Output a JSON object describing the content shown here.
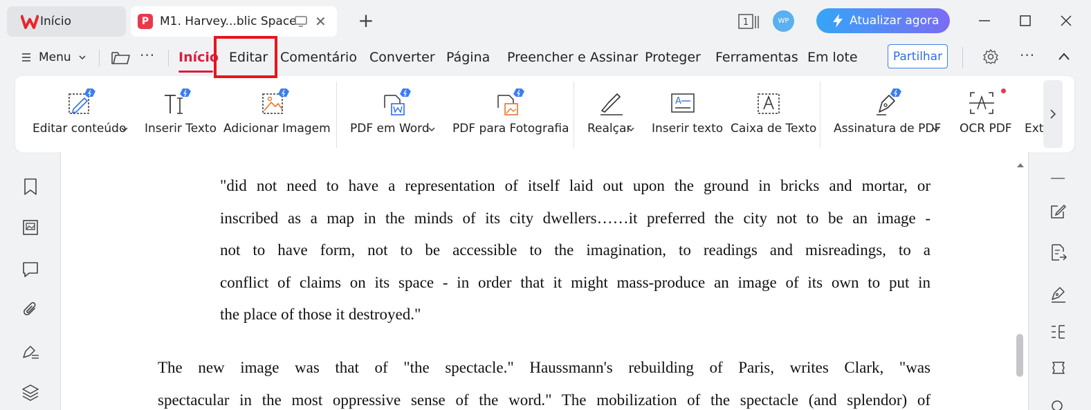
{
  "tabs": {
    "home_label": "Início",
    "doc_label": "M1. Harvey...blic Space"
  },
  "titlebar": {
    "page_count": "1",
    "avatar_text": "WP",
    "upgrade_label": "Atualizar agora"
  },
  "menubar": {
    "menu_label": "Menu",
    "items": [
      "Início",
      "Editar",
      "Comentário",
      "Converter",
      "Página",
      "Preencher e Assinar",
      "Proteger",
      "Ferramentas",
      "Em lote"
    ],
    "share_label": "Partilhar"
  },
  "ribbon": {
    "edit_content": "Editar conteúdo",
    "insert_text": "Inserir Texto",
    "add_image": "Adicionar Imagem",
    "pdf_to_word": "PDF em Word",
    "pdf_to_photo": "PDF para Fotografia",
    "highlight": "Realçar",
    "insert_text2": "Inserir texto",
    "text_box": "Caixa de Texto",
    "pdf_signature": "Assinatura de PDF",
    "ocr_pdf": "OCR PDF",
    "extract": "Extr"
  },
  "document": {
    "quote_lines": [
      "\"did not need to have a representation of itself laid out upon the ground in bricks and mortar, or",
      "inscribed as a map in the minds of its city dwellers……it preferred the city not to be an image -",
      "not to have form, not to be accessible to the imagination, to readings and misreadings, to a",
      "conflict of claims on its space - in order that it might mass-produce an image of its own to put in",
      "the place of those it destroyed.\""
    ],
    "body_lines": [
      "The new image was that of \"the spectacle.\"    Haussmann's rebuilding of Paris, writes Clark, \"was",
      "spectacular in the most oppressive sense of the word.\" The mobilization of the spectacle (and splendor) of"
    ]
  }
}
